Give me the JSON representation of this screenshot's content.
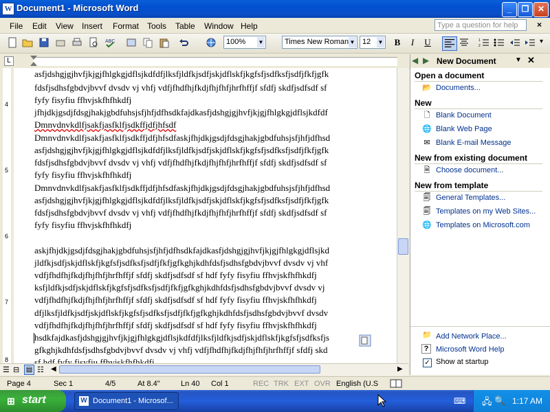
{
  "window": {
    "icon_letter": "W",
    "title": "Document1 - Microsoft Word",
    "controls": {
      "minimize": "_",
      "restore": "❐",
      "close": "✕"
    }
  },
  "menubar": {
    "items": [
      "File",
      "Edit",
      "View",
      "Insert",
      "Format",
      "Tools",
      "Table",
      "Window",
      "Help"
    ],
    "question_placeholder": "Type a question for help",
    "close_glyph": "×"
  },
  "toolbar": {
    "zoom": "100%",
    "font": "Times New Roman",
    "size": "12",
    "bold": "B",
    "italic": "I",
    "underline": "U"
  },
  "document": {
    "lines": [
      "asfjdshgjgjhvfjkjgjfhlgkgjdflsjkdfdfjlksfjldfkjsdfjskjdflskfjkgfsfjsdfksfjsdfjfkfjgfk",
      "fdsfjsdhsfgbdvjbvvf dvsdv vj vhfj vdfjfhdfhjfkdjfhjfhfjhrfhffjf sfdfj skdfjsdfsdf sf",
      "fyfy fisyfiu ffhvjskfhfhkdfj",
      "jfhjdkjgsdjfdsgjhakjgbdfuhsjsfjhfjdfhsdkfajdkasfjdshgjgjhvfjkjgjfhlgkgjdflsjkdfdf",
      "Dmnvdnvkdlfjsakfjasfklfjsdkffjdfjhfsdf",
      "Dmnvdnvkdlfjsakfjasfklfjsdkffjdfjhfsdfaskjfhjdkjgsdjfdsgjhakjgbdfuhsjsfjhfjdfhsd",
      "asfjdshgjgjhvfjkjgjfhlgkgjdflsjkdfdfjlksfjldfkjsdfjskjdflskfjkgfsfjsdfksfjsdfjfkfjgfk",
      "fdsfjsdhsfgbdvjbvvf dvsdv vj vhfj vdfjfhdfhjfkdjfhjfhfjhrfhffjf sfdfj skdfjsdfsdf sf",
      "fyfy fisyfiu ffhvjskfhfhkdfj",
      "Dmnvdnvkdlfjsakfjasfklfjsdkffjdfjhfsdfaskjfhjdkjgsdjfdsgjhakjgbdfuhsjsfjhfjdfhsd",
      "asfjdshgjgjhvfjkjgjfhlgkgjdflsjkdfdfjlksfjldfkjsdfjskjdflskfjkgfsfjsdfksfjsdfjfkfjgfk",
      "fdsfjsdhsfgbdvjbvvf dvsdv vj vhfj vdfjfhdfhjfkdjfhjfhfjhrfhffjf sfdfj skdfjsdfsdf sf",
      "fyfy fisyfiu ffhvjskfhfhkdfj",
      "",
      "askjfhjdkjgsdjfdsgjhakjgbdfuhsjsfjhfjdfhsdkfajdkasfjdshgjgjhvfjkjgjfhlgkgjdflsjkd",
      "jldfkjsdfjskjdflskfjkgfsfjsdfksfjsdfjfkfjgfkghjkdhfdsfjsdhsfgbdvjbvvf dvsdv vj vhf",
      "vdfjfhdfhjfkdjfhjfhfjhrfhffjf sfdfj skdfjsdfsdf sf hdf fyfy fisyfiu ffhvjskfhfhkdfj",
      "ksfjldfkjsdfjskjdflskfjkgfsfjsdfksfjsdfjfkfjgfkghjkdhfdsfjsdhsfgbdvjbvvf dvsdv vj",
      "vdfjfhdfhjfkdjfhjfhfjhrfhffjf sfdfj skdfjsdfsdf sf hdf fyfy fisyfiu ffhvjskfhfhkdfj",
      "dfjlksfjldfkjsdfjskjdflskfjkgfsfjsdfksfjsdfjfkfjgfkghjkdhfdsfjsdhsfgbdvjbvvf dvsdv",
      "vdfjfhdfhjfkdjfhjfhfjhrfhffjf sfdfj skdfjsdfsdf sf hdf fyfy fisyfiu ffhvjskfhfhkdfj",
      "hsdkfajdkasfjdshgjgjhvfjkjgjfhlgkgjdflsjkdfdfjlksfjldfkjsdfjskjdflskfjkgfsfjsdfksfjs",
      "gfkghjkdhfdsfjsdhsfgbdvjbvvf dvsdv vj vhfj vdfjfhdfhjfkdjfhjfhfjhrfhffjf sfdfj skd",
      "sf hdf fyfy fisyfiu ffhvjskfhfhkdfj"
    ]
  },
  "task_pane": {
    "title": "New Document",
    "sections": [
      {
        "heading": "Open a document",
        "links": [
          "Documents..."
        ]
      },
      {
        "heading": "New",
        "links": [
          "Blank Document",
          "Blank Web Page",
          "Blank E-mail Message"
        ]
      },
      {
        "heading": "New from existing document",
        "links": [
          "Choose document..."
        ]
      },
      {
        "heading": "New from template",
        "links": [
          "General Templates...",
          "Templates on my Web Sites...",
          "Templates on Microsoft.com"
        ]
      }
    ],
    "footer_links": [
      "Add Network Place...",
      "Microsoft Word Help"
    ],
    "show_at_startup": "Show at startup",
    "show_at_startup_checked": true
  },
  "statusbar": {
    "page": "Page 4",
    "sec": "Sec 1",
    "pages": "4/5",
    "at": "At 8.4\"",
    "ln": "Ln 40",
    "col": "Col 1",
    "rec": "REC",
    "trk": "TRK",
    "ext": "EXT",
    "ovr": "OVR",
    "lang": "English (U.S"
  },
  "ruler": {
    "vertical_labels": [
      "4",
      "5",
      "6",
      "7",
      "8"
    ]
  },
  "taskbar": {
    "start": "start",
    "task_button": "Document1 - Microsof...",
    "clock": "1:17 AM"
  }
}
